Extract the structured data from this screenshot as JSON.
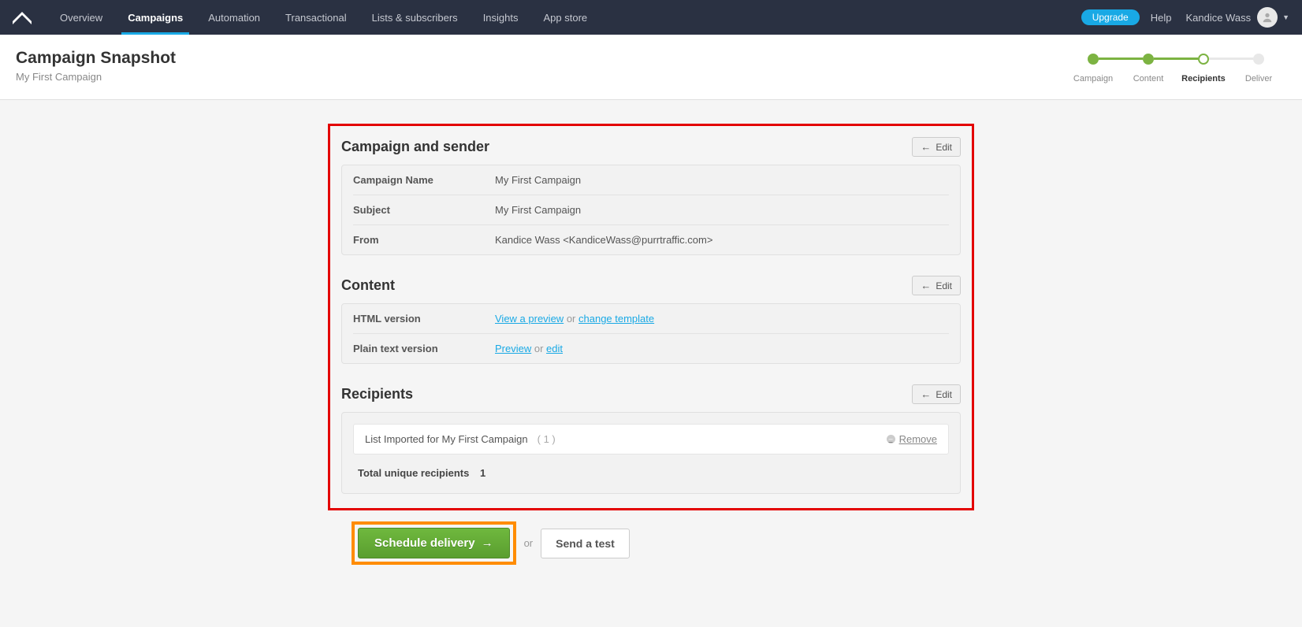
{
  "nav": {
    "items": [
      "Overview",
      "Campaigns",
      "Automation",
      "Transactional",
      "Lists & subscribers",
      "Insights",
      "App store"
    ],
    "upgrade": "Upgrade",
    "help": "Help",
    "user": "Kandice Wass"
  },
  "header": {
    "title": "Campaign Snapshot",
    "subtitle": "My First Campaign"
  },
  "stepper": {
    "steps": [
      "Campaign",
      "Content",
      "Recipients",
      "Deliver"
    ]
  },
  "sections": {
    "campaign": {
      "title": "Campaign and sender",
      "edit": "Edit",
      "rows": {
        "name_label": "Campaign Name",
        "name_value": "My First Campaign",
        "subject_label": "Subject",
        "subject_value": "My First Campaign",
        "from_label": "From",
        "from_value": "Kandice Wass <KandiceWass@purrtraffic.com>"
      }
    },
    "content": {
      "title": "Content",
      "edit": "Edit",
      "html_label": "HTML version",
      "html_preview": "View a preview",
      "html_or": " or ",
      "html_change": "change template",
      "text_label": "Plain text version",
      "text_preview": "Preview",
      "text_or": " or ",
      "text_edit": "edit"
    },
    "recipients": {
      "title": "Recipients",
      "edit": "Edit",
      "list_name": "List Imported for My First Campaign",
      "list_count": "( 1 )",
      "remove": "Remove",
      "total_label": "Total unique recipients",
      "total_value": "1"
    }
  },
  "actions": {
    "schedule": "Schedule delivery",
    "or": "or",
    "send_test": "Send a test"
  }
}
